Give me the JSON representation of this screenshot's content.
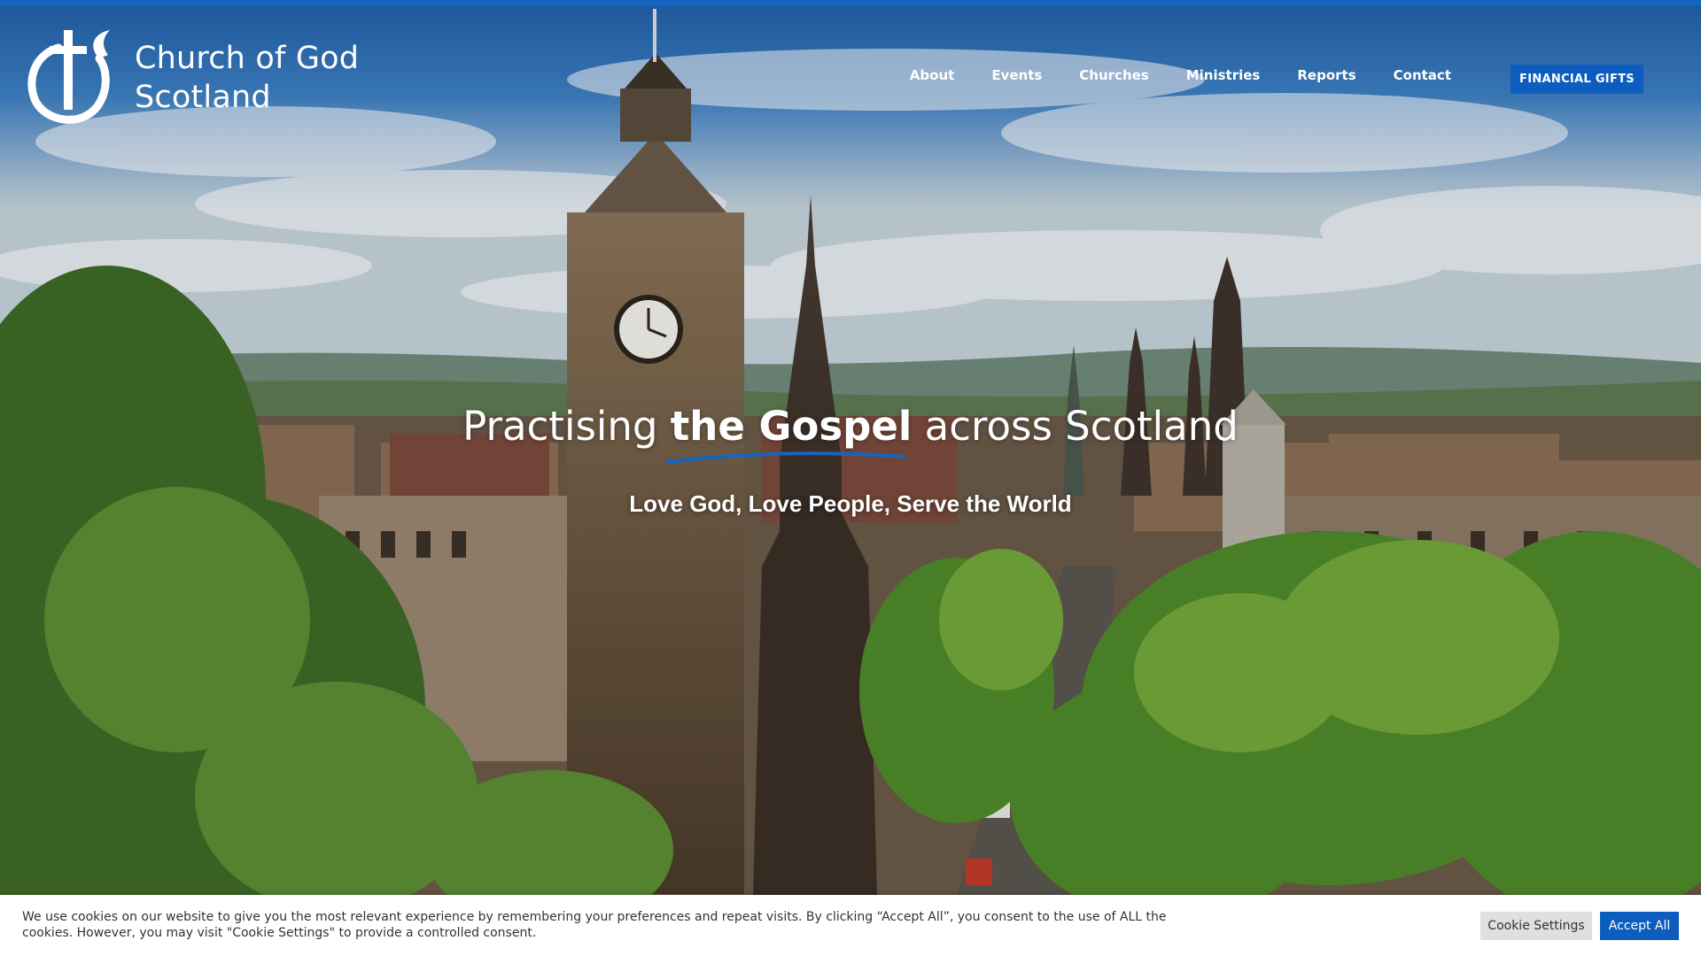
{
  "site": {
    "title_line1": "Church of God",
    "title_line2": "Scotland",
    "brand_color": "#0d5dbf",
    "logo_icon": "cross-dove-icon"
  },
  "nav": {
    "items": [
      "About",
      "Events",
      "Churches",
      "Ministries",
      "Reports",
      "Contact"
    ],
    "cta_label": "FINANCIAL GIFTS"
  },
  "hero": {
    "title_part1": "Practising ",
    "title_strong": "the Gospel",
    "title_part2": " across Scotland",
    "subtitle": "Love God, Love People, Serve the World",
    "background": "edinburgh-skyline-photo"
  },
  "cookie": {
    "message": "We use cookies on our website to give you the most relevant experience by remembering your preferences and repeat visits. By clicking “Accept All”, you consent to the use of ALL the cookies. However, you may visit \"Cookie Settings\" to provide a controlled consent.",
    "settings_label": "Cookie Settings",
    "accept_label": "Accept All"
  }
}
